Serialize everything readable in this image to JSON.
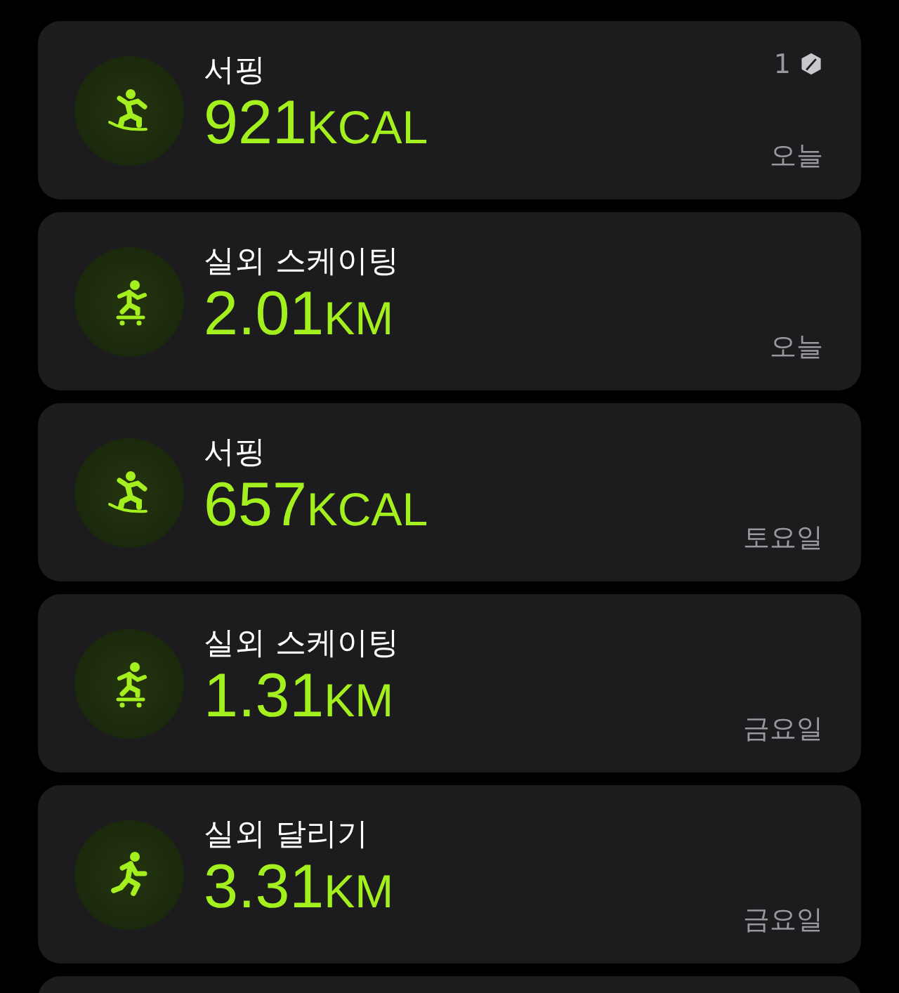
{
  "workouts": [
    {
      "kind": "surfing",
      "title": "서핑",
      "value": "921",
      "unit": "KCAL",
      "date": "오늘",
      "badge": {
        "count": "1"
      }
    },
    {
      "kind": "skating",
      "title": "실외 스케이팅",
      "value": "2.01",
      "unit": "KM",
      "date": "오늘"
    },
    {
      "kind": "surfing",
      "title": "서핑",
      "value": "657",
      "unit": "KCAL",
      "date": "토요일"
    },
    {
      "kind": "skating",
      "title": "실외 스케이팅",
      "value": "1.31",
      "unit": "KM",
      "date": "금요일"
    },
    {
      "kind": "running",
      "title": "실외 달리기",
      "value": "3.31",
      "unit": "KM",
      "date": "금요일"
    },
    {
      "kind": "cut_off"
    }
  ]
}
